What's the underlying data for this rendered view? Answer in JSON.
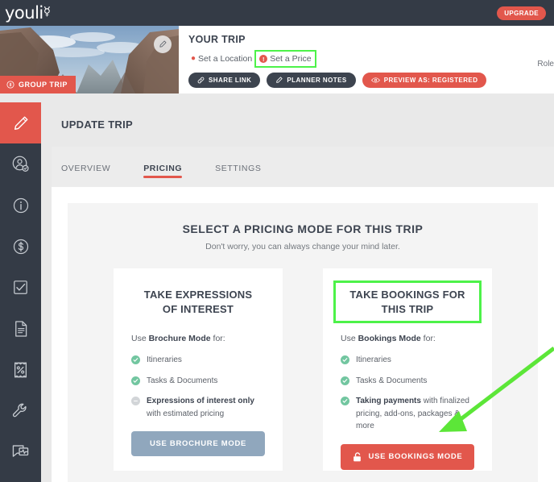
{
  "topnav": {
    "logo_text": "youli",
    "logo_icon": "hot-air-balloon-icon",
    "upgrade_label": "UPGRADE"
  },
  "trip_header": {
    "photo_alt": "canyon-landscape-photo",
    "edit_icon": "pencil-icon",
    "group_badge_label": "GROUP TRIP",
    "group_badge_icon": "info-circle-icon",
    "title": "YOUR TRIP",
    "meta": [
      {
        "icon": "map-pin-icon",
        "label": "Set a Location",
        "highlighted": false
      },
      {
        "icon": "exclamation-circle-icon",
        "label": "Set a Price",
        "highlighted": true
      }
    ],
    "buttons": [
      {
        "icon": "link-icon",
        "label": "SHARE LINK",
        "style": "dark"
      },
      {
        "icon": "pencil-icon",
        "label": "PLANNER NOTES",
        "style": "dark"
      },
      {
        "icon": "eye-icon",
        "label": "PREVIEW AS: REGISTERED",
        "style": "accent"
      }
    ],
    "role_label": "Role"
  },
  "sidebar": {
    "items": [
      {
        "name": "sidebar-item-edit",
        "icon": "pencil-icon",
        "active": true
      },
      {
        "name": "sidebar-item-travellers",
        "icon": "user-check-circle-icon",
        "active": false
      },
      {
        "name": "sidebar-item-info",
        "icon": "info-circle-icon",
        "active": false
      },
      {
        "name": "sidebar-item-pricing",
        "icon": "dollar-circle-icon",
        "active": false
      },
      {
        "name": "sidebar-item-tasks",
        "icon": "checkbox-icon",
        "active": false
      },
      {
        "name": "sidebar-item-documents",
        "icon": "document-icon",
        "active": false
      },
      {
        "name": "sidebar-item-discounts",
        "icon": "ticket-percent-icon",
        "active": false
      },
      {
        "name": "sidebar-item-settings",
        "icon": "wrench-icon",
        "active": false
      },
      {
        "name": "sidebar-item-messages",
        "icon": "chat-activity-icon",
        "active": false
      }
    ]
  },
  "main": {
    "page_title": "UPDATE TRIP",
    "tabs": [
      {
        "label": "OVERVIEW",
        "active": false
      },
      {
        "label": "PRICING",
        "active": true
      },
      {
        "label": "SETTINGS",
        "active": false
      }
    ],
    "panel": {
      "title": "SELECT A PRICING MODE FOR THIS TRIP",
      "subtitle": "Don't worry, you can always change your mind later.",
      "cards": [
        {
          "title_lines": [
            "TAKE EXPRESSIONS",
            "OF INTEREST"
          ],
          "title_highlighted": false,
          "lead_prefix": "Use ",
          "lead_strong": "Brochure Mode",
          "lead_suffix": " for:",
          "features": [
            {
              "state": "check",
              "strong": "",
              "text": "Itineraries"
            },
            {
              "state": "check",
              "strong": "",
              "text": "Tasks & Documents"
            },
            {
              "state": "muted",
              "strong": "Expressions of interest only",
              "text": " with estimated pricing"
            }
          ],
          "button_label": "USE BROCHURE MODE",
          "button_icon": "",
          "button_style": "brochure"
        },
        {
          "title_lines": [
            "TAKE BOOKINGS FOR",
            "THIS TRIP"
          ],
          "title_highlighted": true,
          "lead_prefix": "Use ",
          "lead_strong": "Bookings Mode",
          "lead_suffix": " for:",
          "features": [
            {
              "state": "check",
              "strong": "",
              "text": "Itineraries"
            },
            {
              "state": "check",
              "strong": "",
              "text": "Tasks & Documents"
            },
            {
              "state": "check",
              "strong": "Taking payments",
              "text": " with finalized pricing, add-ons, packages & more"
            }
          ],
          "button_label": "USE BOOKINGS MODE",
          "button_icon": "open-padlock-icon",
          "button_style": "bookings"
        }
      ]
    }
  },
  "annotations": {
    "highlight_color": "#4df249",
    "arrow_color": "#5ce638",
    "arrow_target": "use-bookings-mode-button"
  },
  "colors": {
    "accent": "#e2574c",
    "dark": "#343b46",
    "brochure_button": "#90a7bd",
    "check_green": "#72c6a0"
  }
}
